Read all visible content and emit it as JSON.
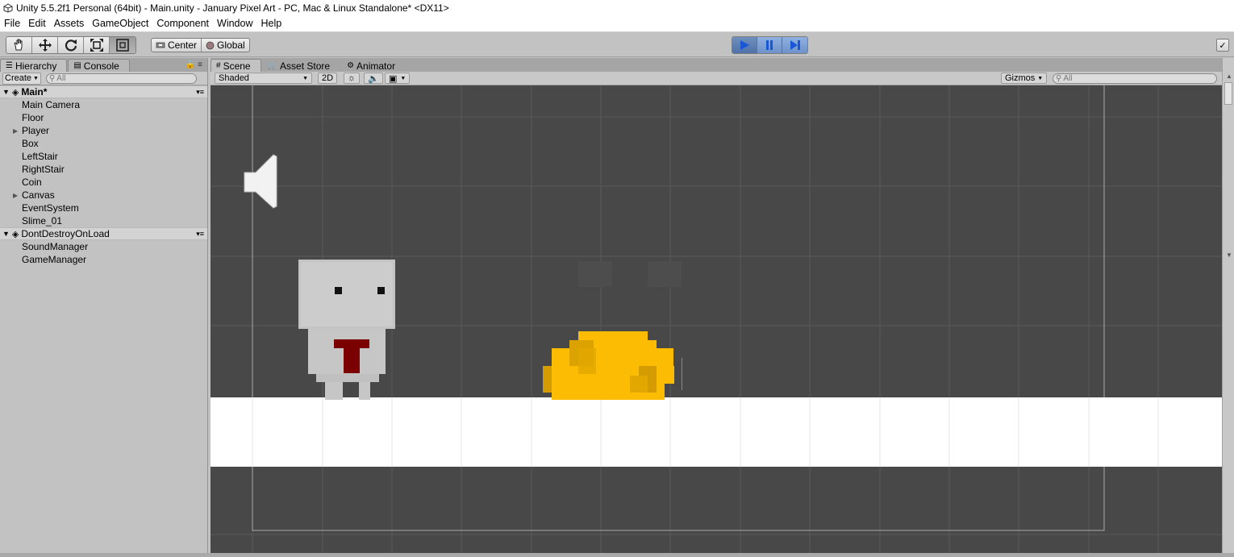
{
  "window": {
    "title": "Unity 5.5.2f1 Personal (64bit) - Main.unity - January Pixel Art - PC, Mac & Linux Standalone* <DX11>"
  },
  "menu": [
    "File",
    "Edit",
    "Assets",
    "GameObject",
    "Component",
    "Window",
    "Help"
  ],
  "toolbar": {
    "tools": [
      "hand-tool-icon",
      "move-tool-icon",
      "rotate-tool-icon",
      "scale-tool-icon",
      "rect-tool-icon"
    ],
    "pivot_label": "Center",
    "space_label": "Global"
  },
  "hierarchy": {
    "tabs": [
      "Hierarchy",
      "Console"
    ],
    "create_label": "Create",
    "search_placeholder": "All",
    "scenes": [
      {
        "name": "Main*",
        "items": [
          {
            "label": "Main Camera",
            "expandable": false
          },
          {
            "label": "Floor",
            "expandable": false
          },
          {
            "label": "Player",
            "expandable": true
          },
          {
            "label": "Box",
            "expandable": false
          },
          {
            "label": "LeftStair",
            "expandable": false
          },
          {
            "label": "RightStair",
            "expandable": false
          },
          {
            "label": "Coin",
            "expandable": false
          },
          {
            "label": "Canvas",
            "expandable": true
          },
          {
            "label": "EventSystem",
            "expandable": false
          },
          {
            "label": "Slime_01",
            "expandable": false
          }
        ]
      },
      {
        "name": "DontDestroyOnLoad",
        "items": [
          {
            "label": "SoundManager",
            "expandable": false
          },
          {
            "label": "GameManager",
            "expandable": false
          }
        ]
      }
    ]
  },
  "scene_view": {
    "tabs": [
      "Scene",
      "Asset Store",
      "Animator"
    ],
    "shading_mode": "Shaded",
    "mode_2d_label": "2D",
    "gizmos_label": "Gizmos",
    "search_placeholder": "All"
  },
  "colors": {
    "viewport_bg": "#484848",
    "floor": "#ffffff",
    "slime": "#fcbc04",
    "slime_shade": "#d9a000",
    "player_tie": "#7b0000",
    "player_body": "#c8c8c8",
    "play_button": "#7f9fd0"
  }
}
